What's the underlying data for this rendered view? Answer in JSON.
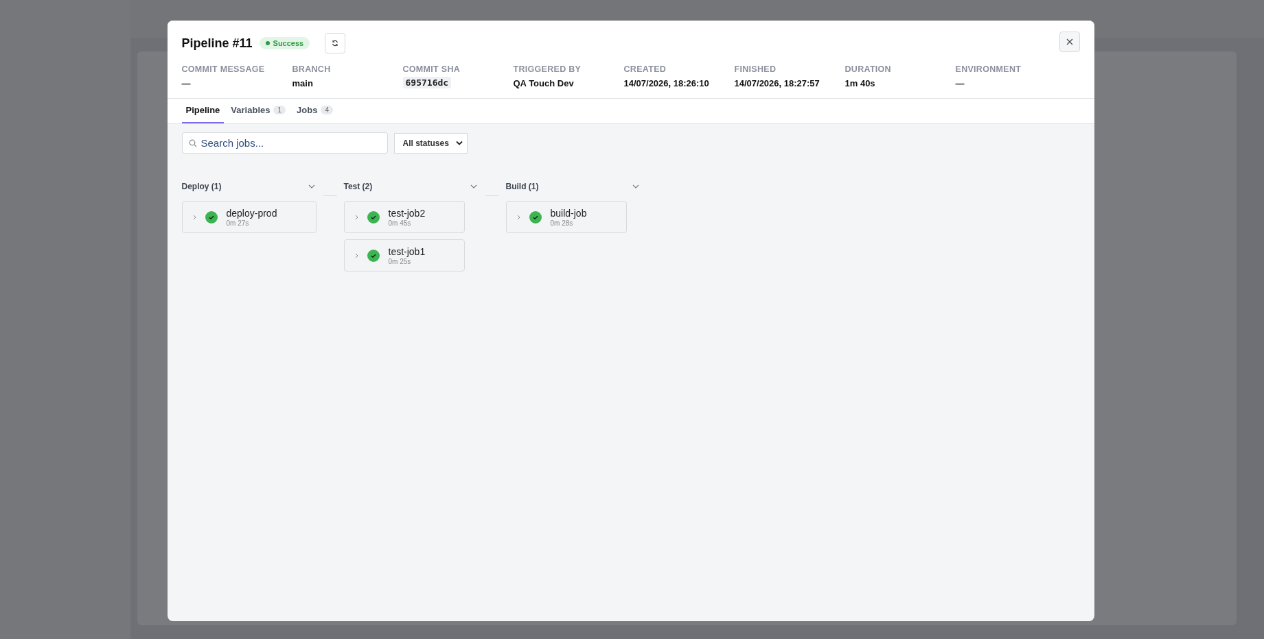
{
  "modal": {
    "title": "Pipeline #11",
    "status": {
      "label": "Success",
      "kind": "success"
    },
    "meta": [
      {
        "label": "COMMIT MESSAGE",
        "value": "—",
        "kind": "text"
      },
      {
        "label": "BRANCH",
        "value": "main",
        "kind": "text"
      },
      {
        "label": "COMMIT SHA",
        "value": "695716dc",
        "kind": "code"
      },
      {
        "label": "TRIGGERED BY",
        "value": "QA Touch Dev",
        "kind": "text"
      },
      {
        "label": "CREATED",
        "value": "14/07/2026, 18:26:10",
        "kind": "text"
      },
      {
        "label": "FINISHED",
        "value": "14/07/2026, 18:27:57",
        "kind": "text"
      },
      {
        "label": "DURATION",
        "value": "1m 40s",
        "kind": "text"
      },
      {
        "label": "ENVIRONMENT",
        "value": "—",
        "kind": "text"
      }
    ],
    "tabs": [
      {
        "label": "Pipeline",
        "selected": true
      },
      {
        "label": "Variables",
        "count": "1",
        "selected": false
      },
      {
        "label": "Jobs",
        "count": "4",
        "selected": false
      }
    ],
    "search": {
      "placeholder": "Search jobs..."
    },
    "status_filter": {
      "value": "All statuses"
    },
    "stages": [
      {
        "name": "Deploy (1)",
        "jobs": [
          {
            "name": "deploy-prod",
            "duration": "0m 27s",
            "passed": true
          }
        ]
      },
      {
        "name": "Test (2)",
        "jobs": [
          {
            "name": "test-job2",
            "duration": "0m 45s",
            "passed": true
          },
          {
            "name": "test-job1",
            "duration": "0m 25s",
            "passed": true
          }
        ]
      },
      {
        "name": "Build (1)",
        "jobs": [
          {
            "name": "build-job",
            "duration": "0m 28s",
            "passed": true
          }
        ]
      }
    ]
  }
}
